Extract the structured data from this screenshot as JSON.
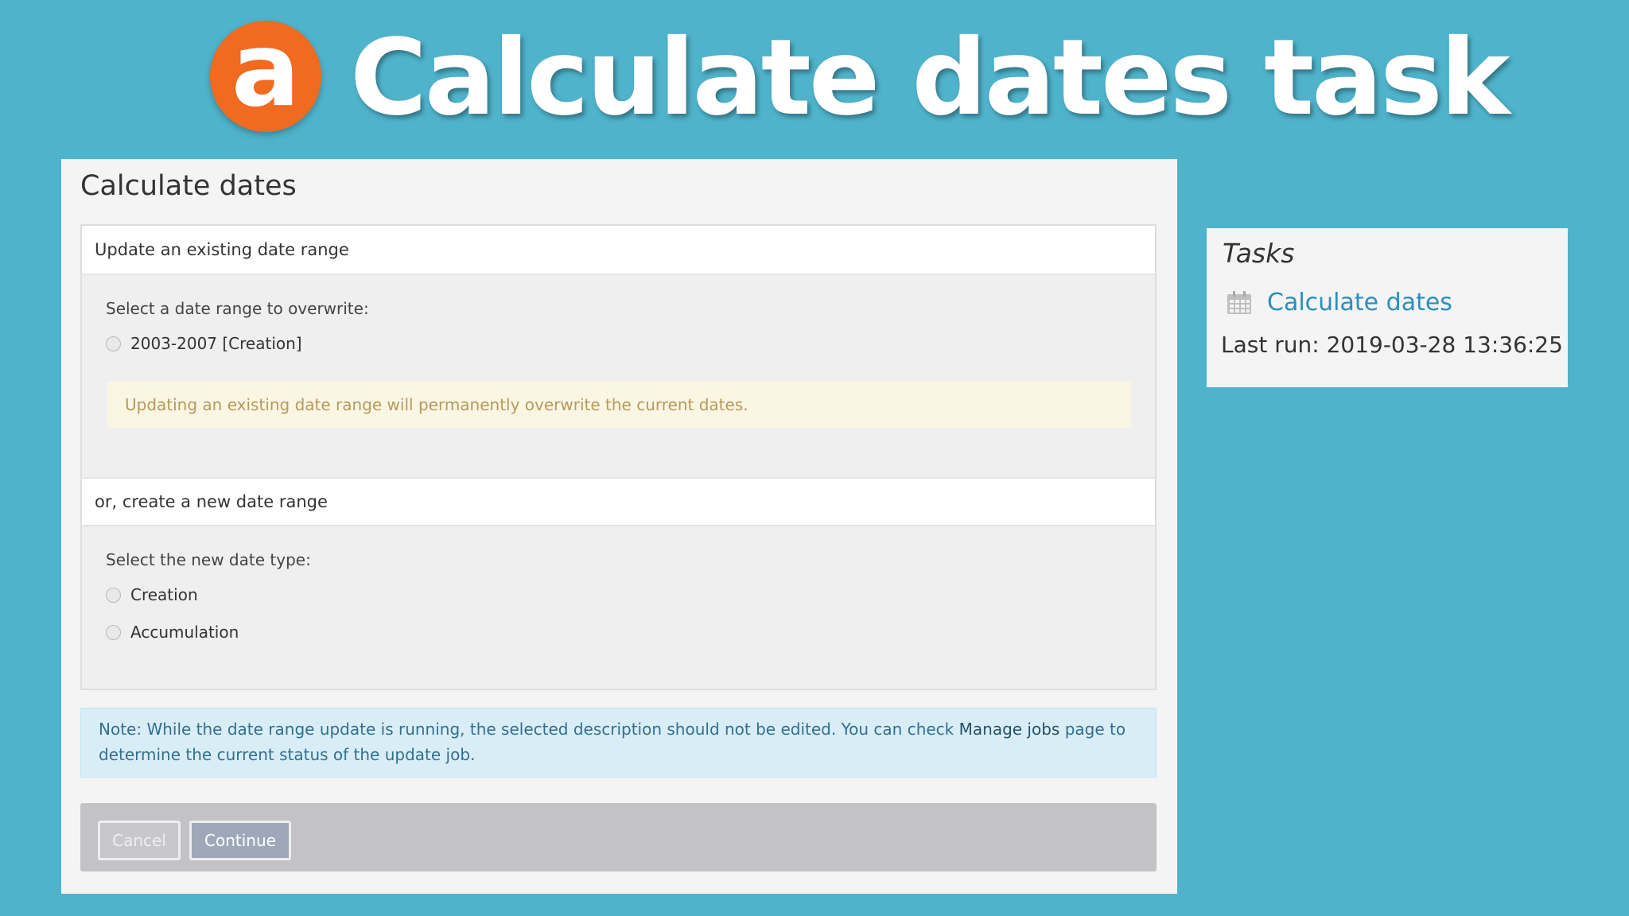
{
  "banner": {
    "logo_letter": "a",
    "title": "Calculate dates task",
    "logo_color": "#f06a1f"
  },
  "panel": {
    "title": "Calculate dates",
    "existing_section": {
      "header": "Update an existing date range",
      "label": "Select a date range to overwrite:",
      "option": "2003-2007 [Creation]",
      "warning": "Updating an existing date range will permanently overwrite the current dates."
    },
    "new_section": {
      "header": "or, create a new date range",
      "label": "Select the new date type:",
      "options": [
        "Creation",
        "Accumulation"
      ]
    },
    "note": {
      "text_before": "Note: While the date range update is running, the selected description should not be edited. You can check ",
      "link": "Manage jobs",
      "text_after": " page to determine the current status of the update job."
    },
    "buttons": {
      "cancel": "Cancel",
      "continue": "Continue"
    }
  },
  "tasks": {
    "title": "Tasks",
    "items": [
      {
        "icon": "calendar-icon",
        "label": "Calculate dates",
        "last_run": "Last run: 2019-03-28 13:36:25"
      }
    ]
  },
  "colors": {
    "background": "#4fb3cb",
    "link": "#2a8fbd",
    "warning_bg": "#fbf5e3",
    "note_bg": "#d9edf7"
  }
}
